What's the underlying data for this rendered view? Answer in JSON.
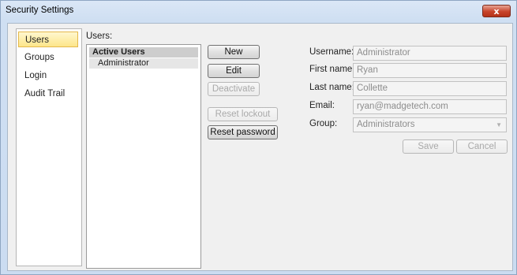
{
  "window": {
    "title": "Security Settings",
    "close_label": "x"
  },
  "nav": {
    "items": [
      {
        "label": "Users",
        "active": true
      },
      {
        "label": "Groups",
        "active": false
      },
      {
        "label": "Login",
        "active": false
      },
      {
        "label": "Audit Trail",
        "active": false
      }
    ]
  },
  "users": {
    "label": "Users:",
    "list_header": "Active Users",
    "list_items": [
      "Administrator"
    ]
  },
  "buttons": {
    "new": "New",
    "edit": "Edit",
    "deactivate": "Deactivate",
    "reset_lockout": "Reset lockout",
    "reset_password": "Reset password",
    "save": "Save",
    "cancel": "Cancel"
  },
  "form": {
    "username_label": "Username:",
    "username_value": "Administrator",
    "first_name_label": "First name:",
    "first_name_value": "Ryan",
    "last_name_label": "Last name:",
    "last_name_value": "Collette",
    "email_label": "Email:",
    "email_value": "ryan@madgetech.com",
    "group_label": "Group:",
    "group_value": "Administrators"
  },
  "colors": {
    "title_gradient": "#cfdff2",
    "active_nav": "#fde68a",
    "close_button": "#c7432a",
    "list_header": "#cdcdcd"
  }
}
